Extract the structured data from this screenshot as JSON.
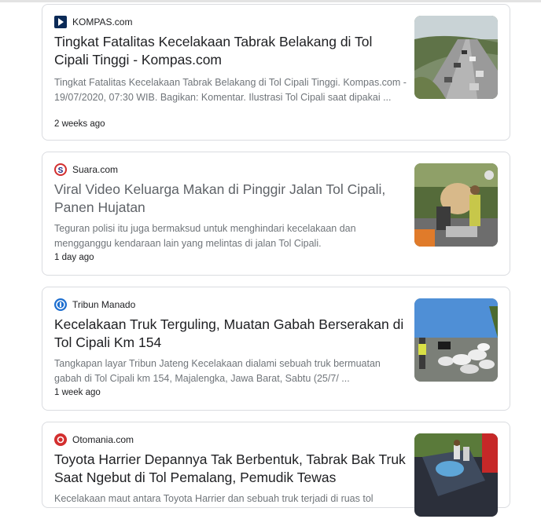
{
  "results": [
    {
      "source": "KOMPAS.com",
      "title": "Tingkat Fatalitas Kecelakaan Tabrak Belakang di Tol Cipali Tinggi - Kompas.com",
      "snippet": "Tingkat Fatalitas Kecelakaan Tabrak Belakang di Tol Cipali Tinggi. Kompas.com - 19/07/2020, 07:30 WIB. Bagikan: Komentar. Ilustrasi Tol Cipali saat dipakai ...",
      "age": "2 weeks ago",
      "thumb_icon": "highway-traffic-photo"
    },
    {
      "source": "Suara.com",
      "title": "Viral Video Keluarga Makan di Pinggir Jalan Tol Cipali, Panen Hujatan",
      "snippet": "Teguran polisi itu juga bermaksud untuk menghindari kecelakaan dan mengganggu kendaraan lain yang melintas di jalan Tol Cipali.",
      "age": "1 day ago",
      "thumb_icon": "roadside-family-photo"
    },
    {
      "source": "Tribun Manado",
      "title": "Kecelakaan Truk Terguling, Muatan Gabah Berserakan di Tol Cipali Km 154",
      "snippet": "Tangkapan layar Tribun Jateng Kecelakaan dialami sebuah truk bermuatan gabah di Tol Cipali km 154, Majalengka, Jawa Barat, Sabtu (25/7/ ...",
      "age": "1 week ago",
      "thumb_icon": "scattered-sacks-photo"
    },
    {
      "source": "Otomania.com",
      "title": "Toyota Harrier Depannya Tak Berbentuk, Tabrak Bak Truk Saat Ngebut di Tol Pemalang, Pemudik Tewas",
      "snippet": "Kecelakaan maut antara Toyota Harrier dan sebuah truk terjadi di ruas tol",
      "age": "",
      "thumb_icon": "car-wreck-photo"
    }
  ],
  "colors": {
    "title_link": "#1a0dab",
    "title_dark": "#202124",
    "title_gray": "#5f6368",
    "snippet": "#70757a",
    "border": "#dadce0"
  }
}
